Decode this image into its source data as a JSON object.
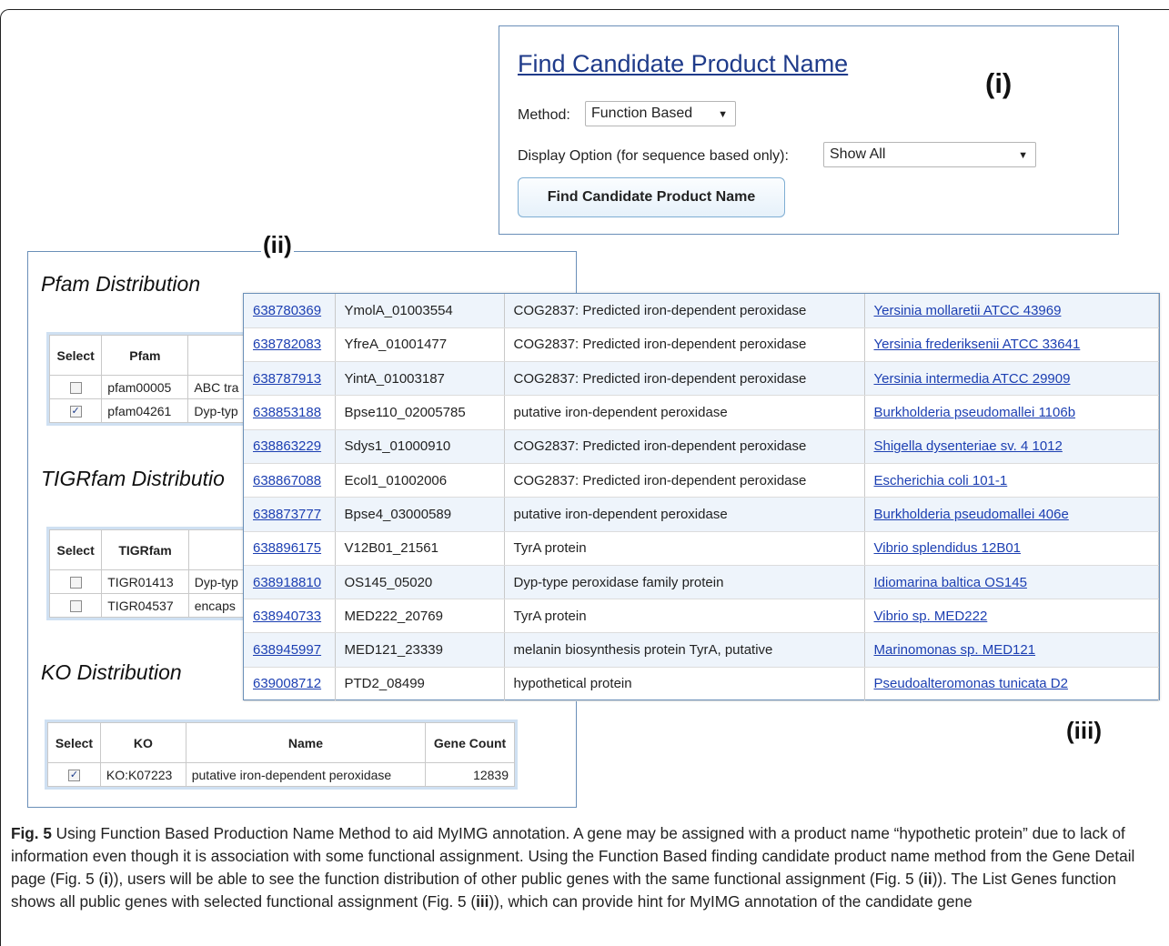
{
  "panel_i": {
    "title": "Find Candidate Product Name",
    "label": "(i)",
    "method_label": "Method:",
    "method_value": "Function Based",
    "display_label": "Display Option (for sequence based only):",
    "display_value": "Show All",
    "button_label": "Find Candidate Product Name"
  },
  "panel_ii": {
    "label": "(ii)",
    "pfam": {
      "title": "Pfam Distribution",
      "headers": [
        "Select",
        "Pfam"
      ],
      "rows": [
        {
          "checked": false,
          "id": "pfam00005",
          "name": "ABC tra"
        },
        {
          "checked": true,
          "id": "pfam04261",
          "name": "Dyp-typ"
        }
      ]
    },
    "tigrfam": {
      "title": "TIGRfam Distributio",
      "headers": [
        "Select",
        "TIGRfam"
      ],
      "rows": [
        {
          "checked": false,
          "id": "TIGR01413",
          "name": "Dyp-typ"
        },
        {
          "checked": false,
          "id": "TIGR04537",
          "name": "encaps"
        }
      ]
    },
    "ko": {
      "title": "KO Distribution",
      "headers": [
        "Select",
        "KO",
        "Name",
        "Gene Count"
      ],
      "rows": [
        {
          "checked": true,
          "id": "KO:K07223",
          "name": "putative iron-dependent peroxidase",
          "count": "12839"
        }
      ]
    }
  },
  "panel_iii": {
    "label": "(iii)",
    "rows": [
      {
        "gene_id": "638780369",
        "locus": "YmolA_01003554",
        "product": "COG2837: Predicted iron-dependent peroxidase",
        "genome": "Yersinia mollaretii ATCC 43969"
      },
      {
        "gene_id": "638782083",
        "locus": "YfreA_01001477",
        "product": "COG2837: Predicted iron-dependent peroxidase",
        "genome": "Yersinia frederiksenii ATCC 33641"
      },
      {
        "gene_id": "638787913",
        "locus": "YintA_01003187",
        "product": "COG2837: Predicted iron-dependent peroxidase",
        "genome": "Yersinia intermedia ATCC 29909"
      },
      {
        "gene_id": "638853188",
        "locus": "Bpse110_02005785",
        "product": "putative iron-dependent peroxidase",
        "genome": "Burkholderia pseudomallei 1106b"
      },
      {
        "gene_id": "638863229",
        "locus": "Sdys1_01000910",
        "product": "COG2837: Predicted iron-dependent peroxidase",
        "genome": "Shigella dysenteriae sv. 4 1012"
      },
      {
        "gene_id": "638867088",
        "locus": "Ecol1_01002006",
        "product": "COG2837: Predicted iron-dependent peroxidase",
        "genome": "Escherichia coli 101-1"
      },
      {
        "gene_id": "638873777",
        "locus": "Bpse4_03000589",
        "product": "putative iron-dependent peroxidase",
        "genome": "Burkholderia pseudomallei 406e"
      },
      {
        "gene_id": "638896175",
        "locus": "V12B01_21561",
        "product": "TyrA protein",
        "genome": "Vibrio splendidus 12B01"
      },
      {
        "gene_id": "638918810",
        "locus": "OS145_05020",
        "product": "Dyp-type peroxidase family protein",
        "genome": "Idiomarina baltica OS145"
      },
      {
        "gene_id": "638940733",
        "locus": "MED222_20769",
        "product": "TyrA protein",
        "genome": "Vibrio sp. MED222"
      },
      {
        "gene_id": "638945997",
        "locus": "MED121_23339",
        "product": "melanin biosynthesis protein TyrA, putative",
        "genome": "Marinomonas sp. MED121"
      },
      {
        "gene_id": "639008712",
        "locus": "PTD2_08499",
        "product": "hypothetical protein",
        "genome": "Pseudoalteromonas tunicata D2"
      }
    ]
  },
  "caption": {
    "fig_label": "Fig. 5",
    "t1": " Using Function Based Production Name Method to aid MyIMG annotation. A gene may be assigned with a product name “hypothetic protein” due to lack of information even though it is association with some functional assignment. Using the Function Based finding candidate product name method from the Gene Detail page (Fig. 5 (",
    "b1": "i",
    "t2": ")), users will be able to see the function distribution of other public genes with the same functional assignment (Fig. 5 (",
    "b2": "ii",
    "t3": ")). The List Genes function shows all public genes with selected functional assignment (Fig. 5 (",
    "b3": "iii",
    "t4": ")), which can provide hint for MyIMG annotation of the candidate gene"
  }
}
